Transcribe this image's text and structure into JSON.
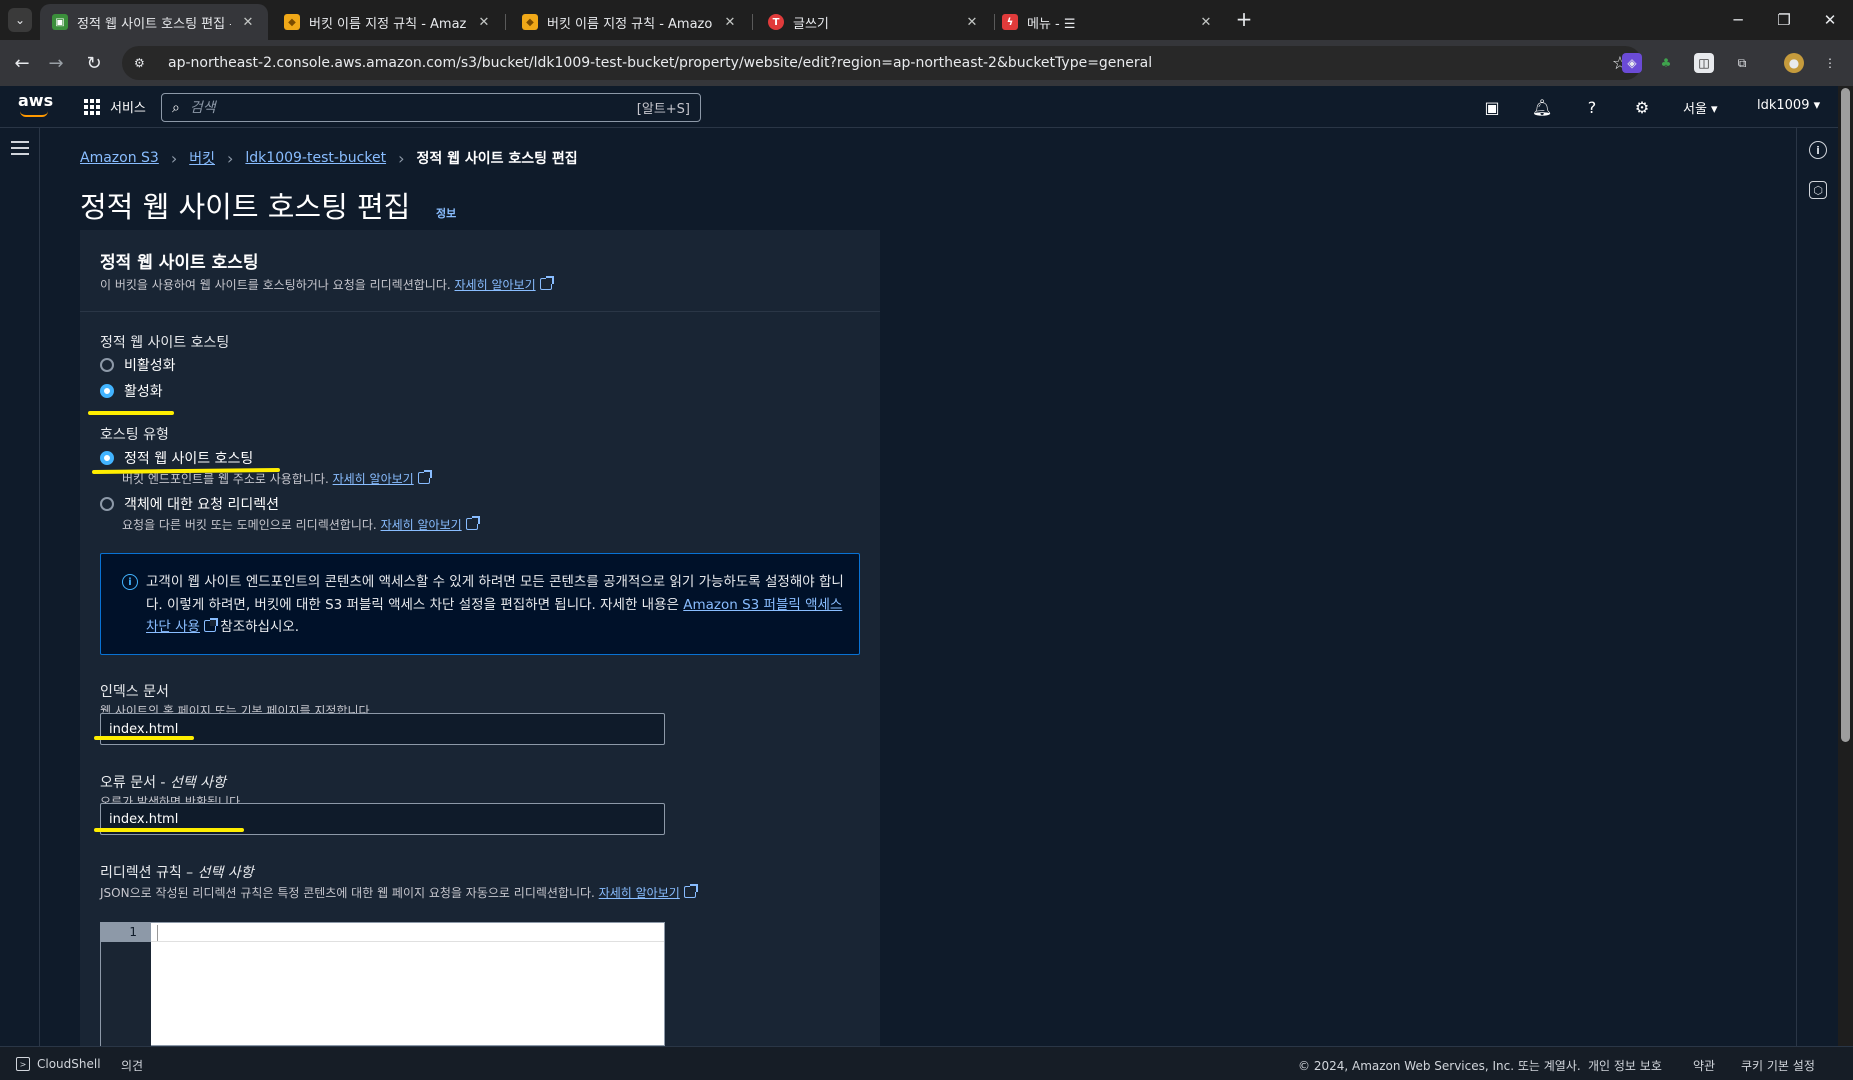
{
  "browser": {
    "tabs": [
      {
        "title": "정적 웹 사이트 호스팅 편집 – S",
        "favicon_color": "#3b8f3b",
        "active": true
      },
      {
        "title": "버킷 이름 지정 규칙 - Amazon",
        "favicon_color": "#f0a818",
        "active": false
      },
      {
        "title": "버킷 이름 지정 규칙 - Amazon",
        "favicon_color": "#f0a818",
        "active": false
      },
      {
        "title": "글쓰기",
        "favicon_color": "#e03b3b",
        "active": false
      },
      {
        "title": "메뉴 - ☰",
        "favicon_color": "#e03b3b",
        "active": false
      }
    ],
    "close_glyph": "✕",
    "new_tab_glyph": "+",
    "url": "ap-northeast-2.console.aws.amazon.com/s3/bucket/ldk1009-test-bucket/property/website/edit?region=ap-northeast-2&bucketType=general"
  },
  "aws_nav": {
    "logo": "aws",
    "services_label": "서비스",
    "search_placeholder": "검색",
    "search_shortcut": "[알트+S]",
    "region": "서울 ▾",
    "account": "ldk1009 ▾"
  },
  "breadcrumb": {
    "items": [
      "Amazon S3",
      "버킷",
      "ldk1009-test-bucket"
    ],
    "current": "정적 웹 사이트 호스팅 편집"
  },
  "page": {
    "title": "정적 웹 사이트 호스팅 편집",
    "info": "정보"
  },
  "panel": {
    "title": "정적 웹 사이트 호스팅",
    "desc": "이 버킷을 사용하여 웹 사이트를 호스팅하거나 요청을 리디렉션합니다.",
    "learn_more": "자세히 알아보기"
  },
  "hosting": {
    "label": "정적 웹 사이트 호스팅",
    "options": [
      "비활성화",
      "활성화"
    ],
    "selected": "활성화"
  },
  "hosting_type": {
    "label": "호스팅 유형",
    "options": [
      {
        "label": "정적 웹 사이트 호스팅",
        "desc": "버킷 엔드포인트를 웹 주소로 사용합니다.",
        "link": "자세히 알아보기"
      },
      {
        "label": "객체에 대한 요청 리디렉션",
        "desc": "요청을 다른 버킷 또는 도메인으로 리디렉션합니다.",
        "link": "자세히 알아보기"
      }
    ],
    "selected": "정적 웹 사이트 호스팅"
  },
  "alert": {
    "text_1": "고객이 웹 사이트 엔드포인트의 콘텐츠에 액세스할 수 있게 하려면 모든 콘텐츠를 공개적으로 읽기 가능하도록 설정해야 합니다. 이렇게 하려면, 버킷에 대한 S3 퍼블릭 액세스 차단 설정을 편집하면 됩니다. 자세한 내용은 ",
    "link": "Amazon S3 퍼블릭 액세스 차단 사용",
    "text_2": " 참조하십시오."
  },
  "index_doc": {
    "label": "인덱스 문서",
    "hint": "웹 사이트의 홈 페이지 또는 기본 페이지를 지정합니다.",
    "value": "index.html"
  },
  "error_doc": {
    "label": "오류 문서 - ",
    "label_optional": "선택 사항",
    "hint": "오류가 발생하면 반환됩니다.",
    "value": "index.html"
  },
  "redirect_rules": {
    "label": "리디렉션 규칙 – ",
    "label_optional": "선택 사항",
    "hint": "JSON으로 작성된 리디렉션 규칙은 특정 콘텐츠에 대한 웹 페이지 요청을 자동으로 리디렉션합니다.",
    "link": "자세히 알아보기",
    "line_number": "1"
  },
  "footer": {
    "cloudshell": "CloudShell",
    "feedback": "의견",
    "copyright": "© 2024, Amazon Web Services, Inc. 또는 계열사.",
    "privacy": "개인 정보 보호",
    "terms": "약관",
    "cookies": "쿠키 기본 설정"
  },
  "colors": {
    "accent_blue": "#42b4ff",
    "link_blue": "#89bdff",
    "annotation": "#ffee00",
    "aws_orange": "#ff9900"
  }
}
